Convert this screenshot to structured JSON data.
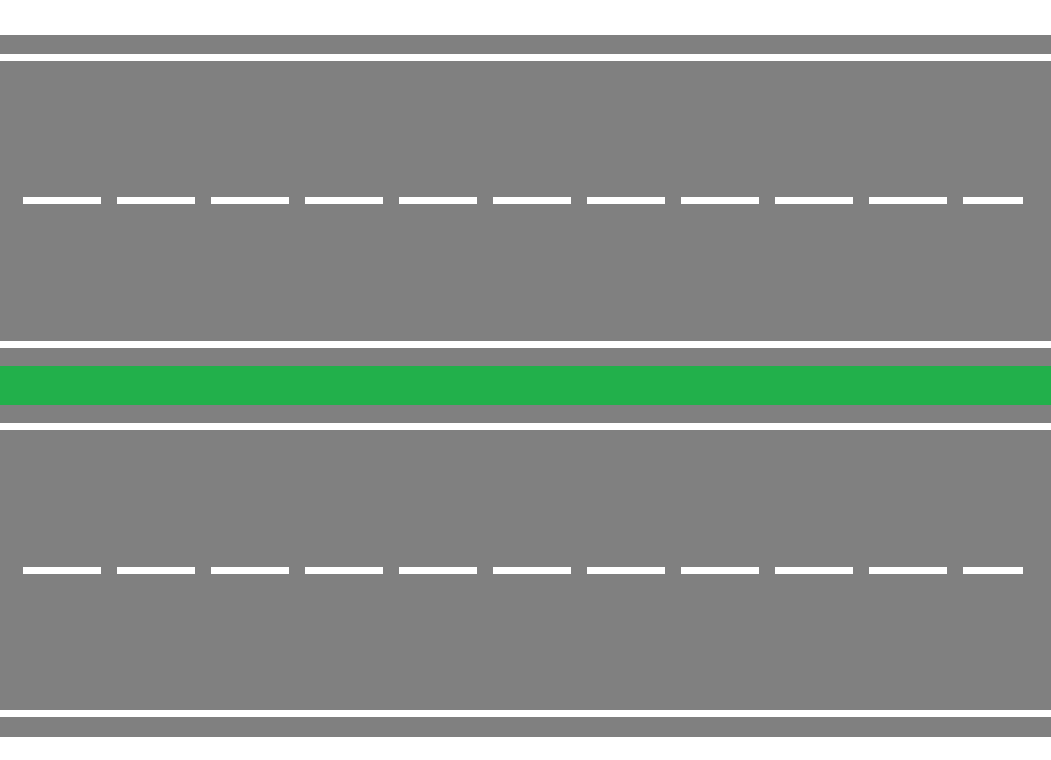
{
  "scene": {
    "colors": {
      "background": "#ffffff",
      "asphalt": "#808080",
      "median": "#22b04b",
      "marking": "#ffffff"
    },
    "carriageways": [
      {
        "id": "upper",
        "lanes": 2
      },
      {
        "id": "lower",
        "lanes": 2
      }
    ]
  }
}
